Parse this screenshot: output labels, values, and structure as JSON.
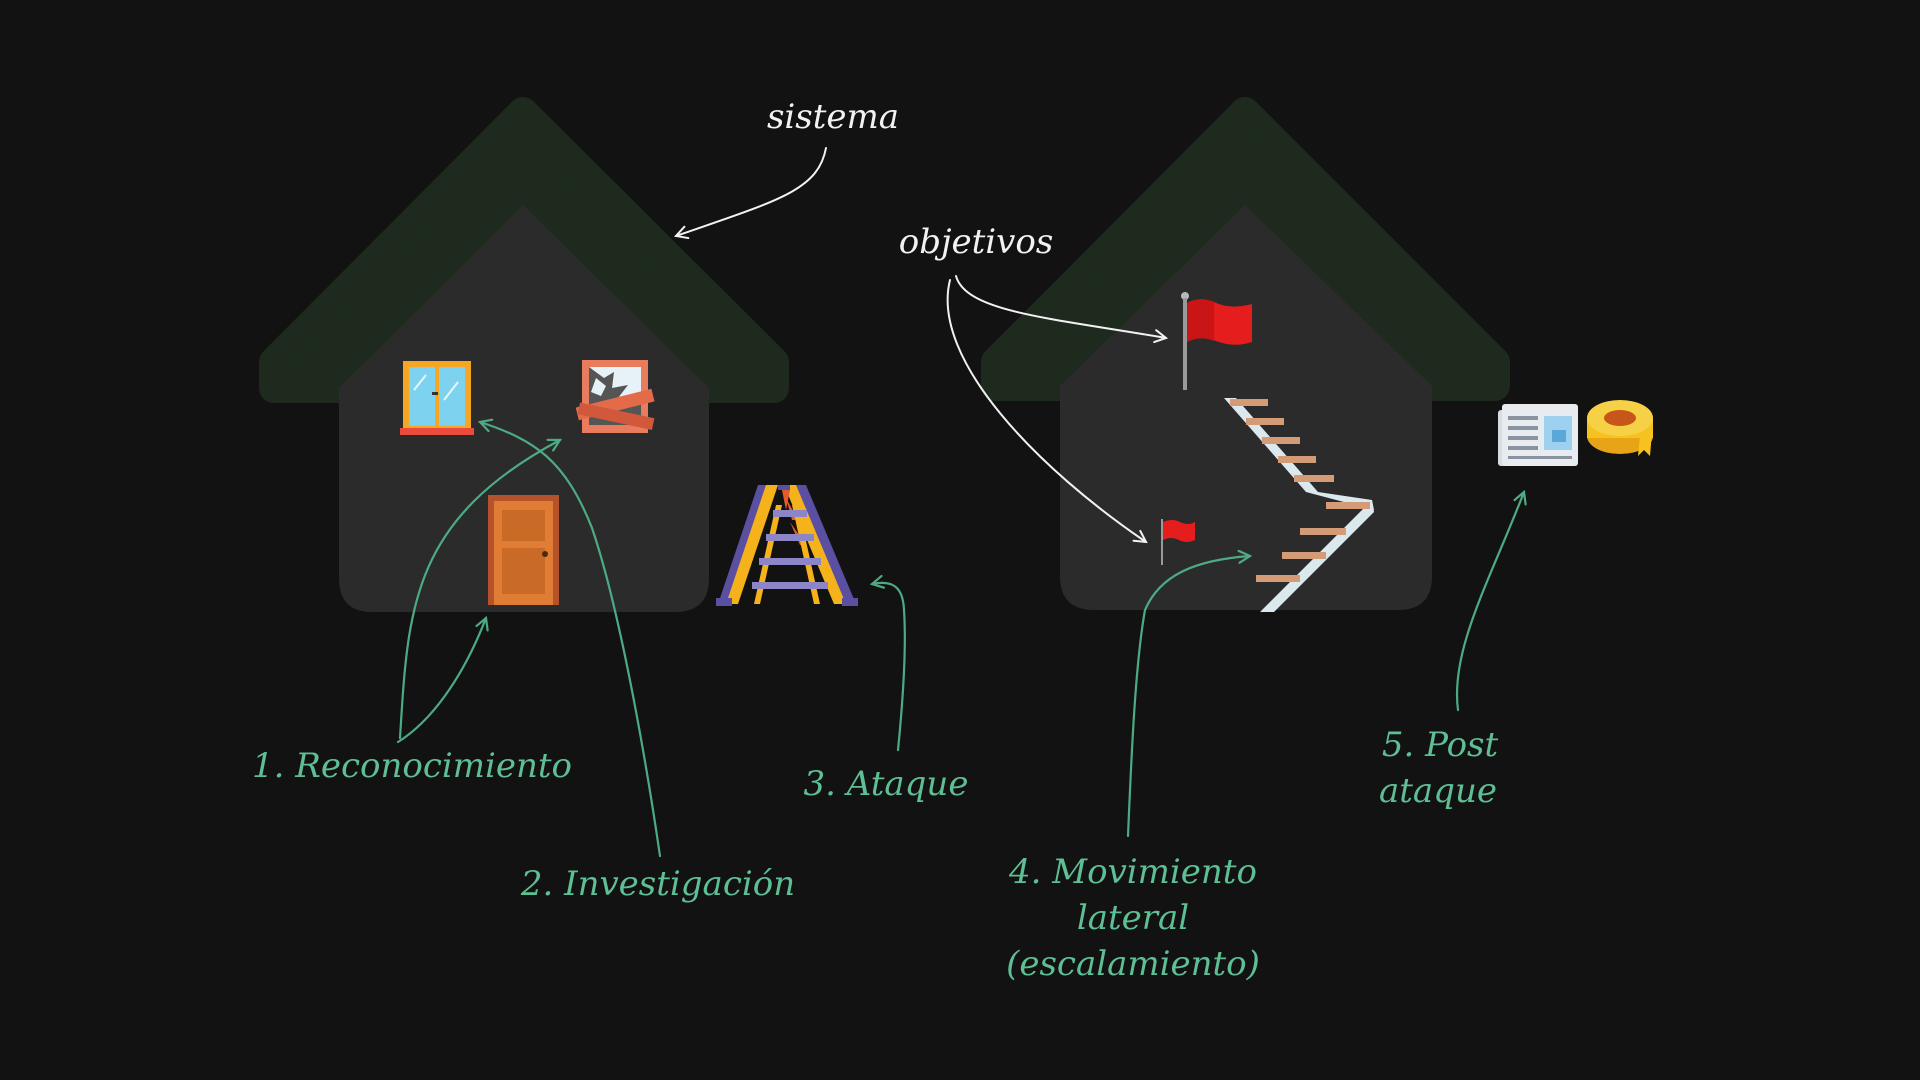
{
  "labels": {
    "system": "sistema",
    "objectives": "objetivos",
    "step1": "1. Reconocimiento",
    "step2": "2. Investigación",
    "step3": "3. Ataque",
    "step4_line1": "4. Movimiento",
    "step4_line2": "lateral",
    "step4_line3": "(escalamiento)",
    "step5_line1": "5. Post",
    "step5_line2": "ataque"
  },
  "colors": {
    "background": "#121212",
    "house_body": "#2b2b2b",
    "house_roof": "#1d2a1d",
    "annotation_green": "#5fbf94",
    "annotation_white": "#f2f2f2",
    "flag_red": "#e51d1d"
  },
  "icons": {
    "house_left": "house-icon",
    "house_right": "house-icon",
    "window": "window-icon",
    "broken_window": "broken-window-icon",
    "door": "door-icon",
    "ladder": "ladder-icon",
    "flag_large": "red-flag-icon",
    "flag_small": "red-flag-icon",
    "staircase": "staircase-icon",
    "newspaper": "newspaper-icon",
    "tape": "tape-roll-icon"
  }
}
